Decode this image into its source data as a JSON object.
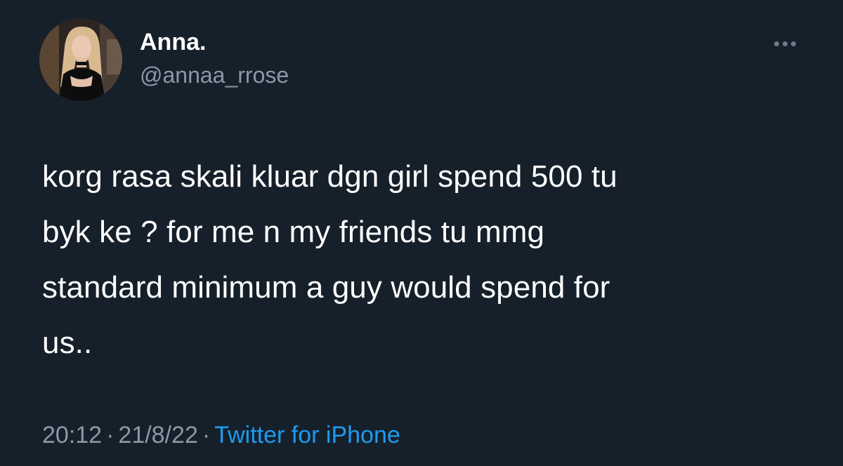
{
  "user": {
    "display_name": "Anna.",
    "handle": "@annaa_rrose",
    "avatar_icon": "profile-photo"
  },
  "tweet": {
    "lines": [
      "korg rasa skali kluar dgn girl spend 500 tu",
      "byk ke ? for me n my friends tu mmg",
      "standard minimum a guy would spend for",
      "us.."
    ]
  },
  "meta": {
    "time": "20:12",
    "separator": "·",
    "date": "21/8/22",
    "source": "Twitter for iPhone"
  },
  "actions": {
    "more_icon": "more-horizontal-icon"
  },
  "colors": {
    "background": "#15202b",
    "text": "#ffffff",
    "secondary_text": "#8b98a5",
    "link": "#1d9bf0"
  }
}
